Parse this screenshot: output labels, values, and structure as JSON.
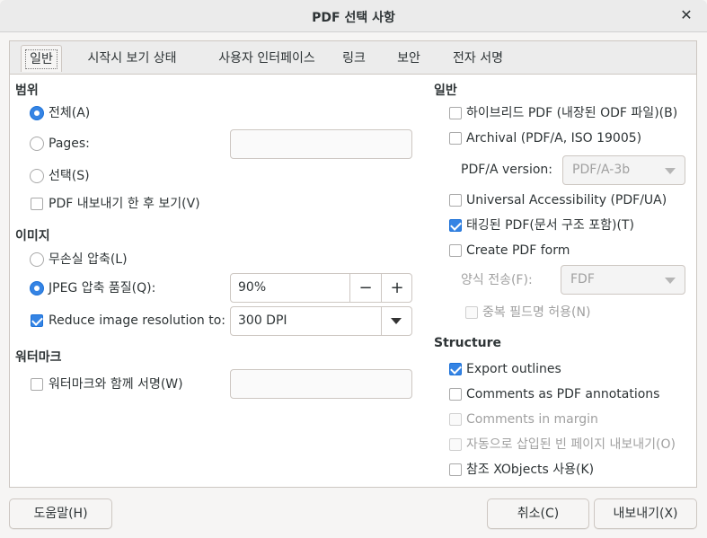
{
  "window": {
    "title": "PDF 선택 사항"
  },
  "tabs": [
    "일반",
    "시작시 보기 상태",
    "사용자 인터페이스",
    "링크",
    "보안",
    "전자 서명"
  ],
  "left": {
    "range": {
      "title": "범위",
      "all": "전체(A)",
      "pages": "Pages:",
      "pages_value": "",
      "selection": "선택(S)",
      "view_after": "PDF 내보내기 한 후 보기(V)"
    },
    "images": {
      "title": "이미지",
      "lossless": "무손실 압축(L)",
      "jpeg": "JPEG 압축  품질(Q):",
      "jpeg_value": "90%",
      "minus": "−",
      "plus": "+",
      "reduce": "Reduce image resolution to:",
      "reduce_value": "300 DPI"
    },
    "watermark": {
      "title": "워터마크",
      "sign": "워터마크와 함께 서명(W)",
      "sign_value": ""
    }
  },
  "right": {
    "general": {
      "title": "일반",
      "hybrid": "하이브리드 PDF (내장된 ODF 파일)(B)",
      "archival": "Archival (PDF/A, ISO 19005)",
      "pdfa_label": "PDF/A version:",
      "pdfa_value": "PDF/A-3b",
      "accessibility": "Universal Accessibility (PDF/UA)",
      "tagged": "태깅된 PDF(문서 구조 포함)(T)",
      "form": "Create PDF form",
      "submit_label": "양식 전송(F):",
      "submit_value": "FDF",
      "duplicate": "중복 필드명 허용(N)"
    },
    "structure": {
      "title": "Structure",
      "outlines": "Export outlines",
      "comments": "Comments as PDF annotations",
      "comments_margin": "Comments in margin",
      "blank_pages": "자동으로 삽입된 빈 페이지 내보내기(O)",
      "xobjects": "참조 XObjects 사용(K)"
    }
  },
  "buttons": {
    "help": "도움말(H)",
    "cancel": "취소(C)",
    "export": "내보내기(X)"
  },
  "colors": {
    "accent": "#3584e4"
  }
}
